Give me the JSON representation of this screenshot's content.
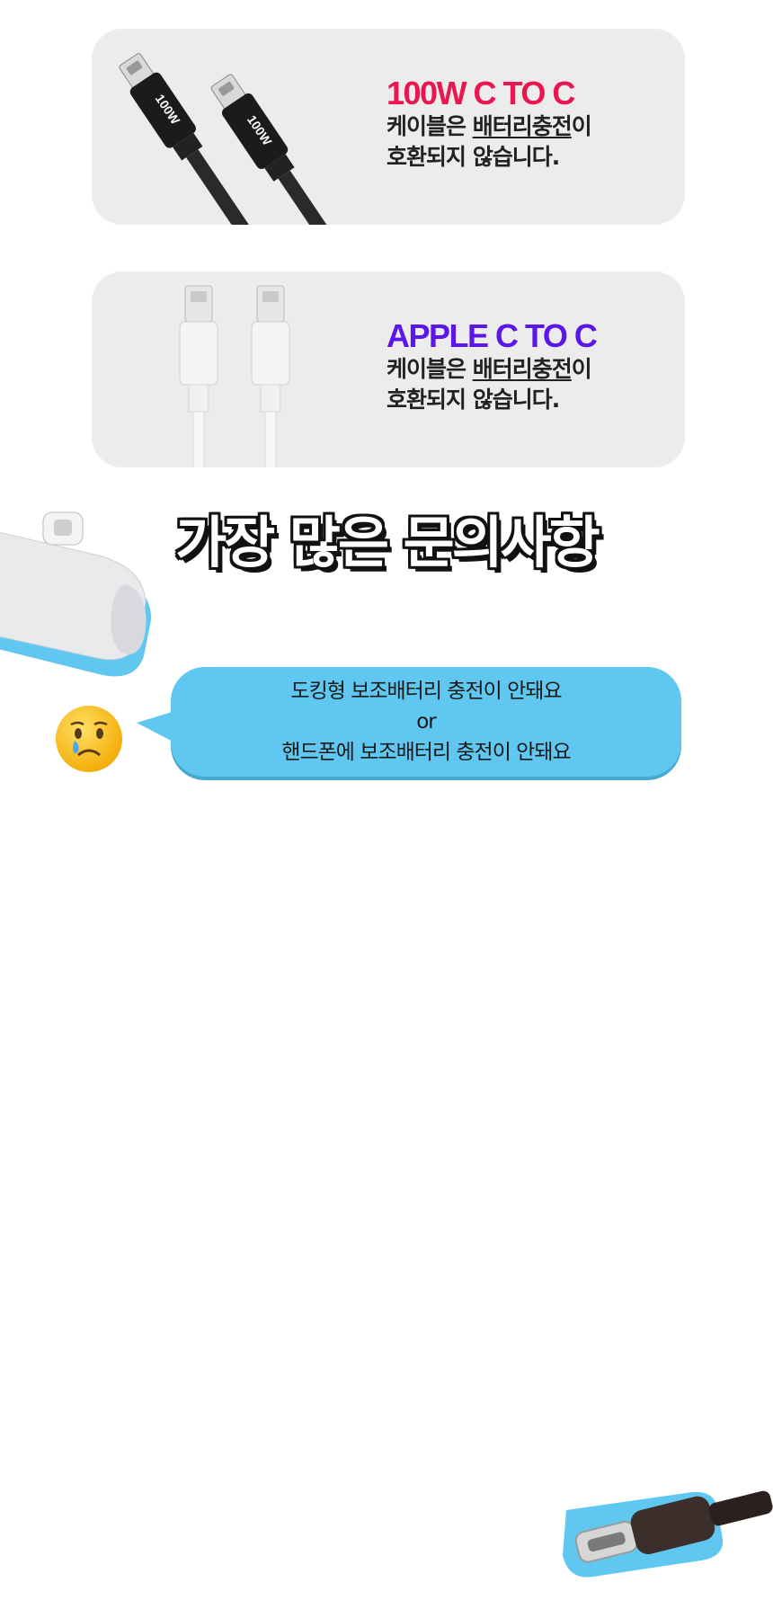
{
  "cards": [
    {
      "headline": "100W C TO C",
      "line1_prefix": "케이블은 ",
      "line1_underlined": "배터리충전",
      "line1_suffix": "이",
      "line2": "호환되지 않습니다.",
      "cable_label": "100W",
      "accent_color": "#e8174f",
      "cable_color": "black"
    },
    {
      "headline": "APPLE C TO C",
      "line1_prefix": "케이블은 ",
      "line1_underlined": "배터리충전",
      "line1_suffix": "이",
      "line2": "호환되지 않습니다.",
      "accent_color": "#5b16e8",
      "cable_color": "white"
    }
  ],
  "faq": {
    "title": "가장 많은 문의사항",
    "bubble": {
      "line1": "도킹형 보조배터리 충전이 안돼요",
      "line2": "or",
      "line3": "핸드폰에 보조배터리 충전이 안돼요",
      "color": "#5fc7f0"
    },
    "emoji_icon": "crying-face-icon"
  }
}
